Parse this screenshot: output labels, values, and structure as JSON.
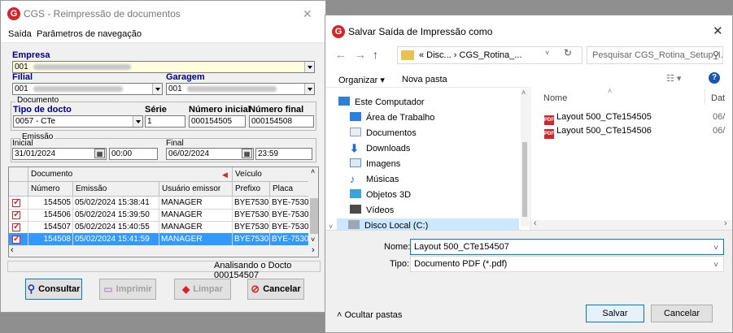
{
  "cgs": {
    "title": "CGS - Reimpressão de documentos",
    "menu": [
      "Saída",
      "Parâmetros de navegação"
    ],
    "empresa": {
      "label": "Empresa",
      "value": "001"
    },
    "filial": {
      "label": "Filial",
      "value": "001"
    },
    "garagem": {
      "label": "Garagem",
      "value": "001"
    },
    "documento_group": "Documento",
    "tipo_docto": {
      "label": "Tipo de docto",
      "value": "0057 - CTe"
    },
    "serie": {
      "label": "Série",
      "value": "1"
    },
    "numero_inicial": {
      "label": "Número inicial",
      "value": "000154505"
    },
    "numero_final": {
      "label": "Número final",
      "value": "000154508"
    },
    "emissao_group": "Emissão",
    "inicial": {
      "label": "Inicial",
      "date": "31/01/2024",
      "time": "00:00"
    },
    "final": {
      "label": "Final",
      "date": "06/02/2024",
      "time": "23:59"
    },
    "grid": {
      "band_left": "Documento",
      "band_right": "Veículo",
      "columns": [
        "Número",
        "Emissão",
        "Usuário emissor",
        "Prefixo",
        "Placa"
      ],
      "rows": [
        {
          "numero": "154505",
          "emissao": "05/02/2024 15:38:41",
          "usuario": "MANAGER",
          "prefixo": "BYE7530",
          "placa": "BYE-7530",
          "selected": false
        },
        {
          "numero": "154506",
          "emissao": "05/02/2024 15:39:50",
          "usuario": "MANAGER",
          "prefixo": "BYE7530",
          "placa": "BYE-7530",
          "selected": false
        },
        {
          "numero": "154507",
          "emissao": "05/02/2024 15:40:55",
          "usuario": "MANAGER",
          "prefixo": "BYE7530",
          "placa": "BYE-7530",
          "selected": false
        },
        {
          "numero": "154508",
          "emissao": "05/02/2024 15:41:59",
          "usuario": "MANAGER",
          "prefixo": "BYE7530",
          "placa": "BYE-7530",
          "selected": true
        }
      ]
    },
    "status_text": "Analisando o Docto 000154507",
    "buttons": {
      "consultar": "Consultar",
      "imprimir": "Imprimir",
      "limpar": "Limpar",
      "cancelar": "Cancelar"
    }
  },
  "save_dialog": {
    "title": "Salvar Saída de Impressão como",
    "address": "« Disc...  ›  CGS_Rotina_...",
    "search_placeholder": "Pesquisar CGS_Rotina_Setup_I...",
    "toolbar": {
      "organizar": "Organizar ▾",
      "nova_pasta": "Nova pasta"
    },
    "tree": [
      "Este Computador",
      "Área de Trabalho",
      "Documentos",
      "Downloads",
      "Imagens",
      "Músicas",
      "Objetos 3D",
      "Vídeos",
      "Disco Local (C:)"
    ],
    "list_header": {
      "nome": "Nome",
      "data": "Dat"
    },
    "files": [
      {
        "name": "Layout 500_CTe154505",
        "date": "06/"
      },
      {
        "name": "Layout 500_CTe154506",
        "date": "06/"
      }
    ],
    "nome": {
      "label": "Nome:",
      "value": "Layout 500_CTe154507"
    },
    "tipo": {
      "label": "Tipo:",
      "value": "Documento PDF (*.pdf)"
    },
    "ocultar": "Ocultar pastas",
    "salvar": "Salvar",
    "cancelar": "Cancelar"
  },
  "colors": {
    "accent": "#d4252c",
    "selection": "#3399ff",
    "label_blue": "#000080",
    "focus": "#0078d7"
  }
}
